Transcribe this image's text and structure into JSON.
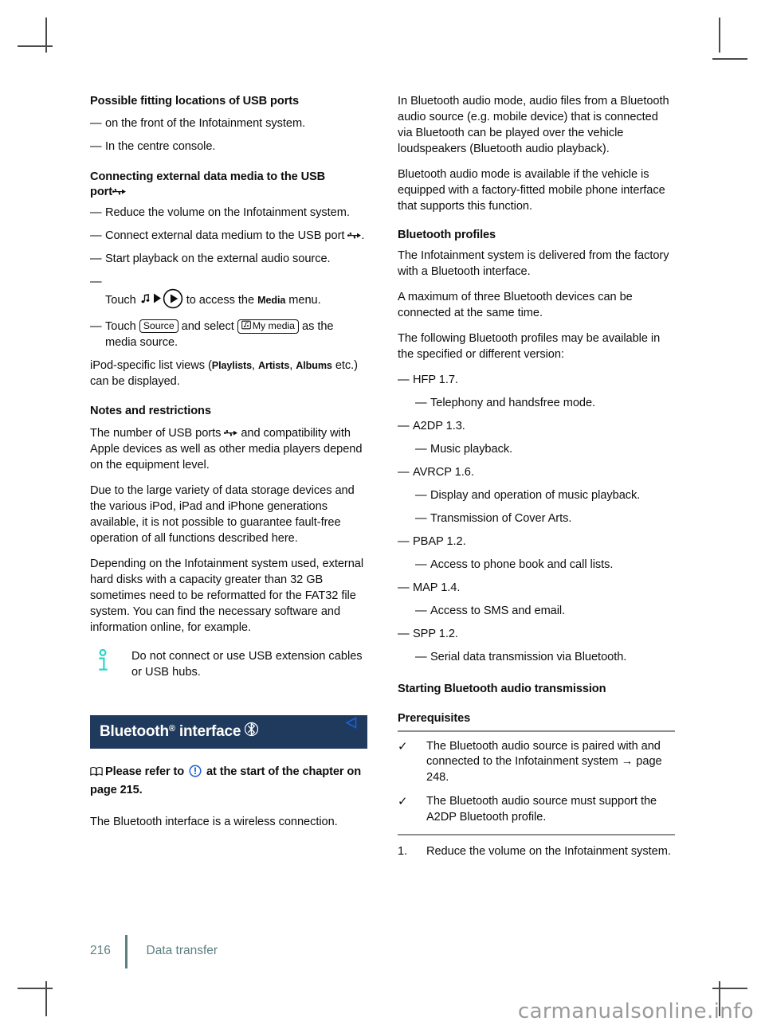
{
  "left_column": {
    "heading_1": "Possible fitting locations of USB ports",
    "list_1": [
      "on the front of the Infotainment system.",
      "In the centre console."
    ],
    "heading_2_line1": "Connecting external data media to the USB",
    "heading_2_line2": "port",
    "steps": {
      "step_1": "Reduce the volume on the Infotainment system.",
      "step_2_pre": "Connect external data medium to the USB port ",
      "step_2_post": ".",
      "step_3": "Start playback on the external audio source.",
      "step_4_pre": "Touch ",
      "step_4_mid": " to access the ",
      "step_4_ui": "Media",
      "step_4_post": " menu.",
      "step_5_pre": "Touch ",
      "step_5_chip_1": "Source",
      "step_5_mid": " and select ",
      "step_5_chip_2": "My media",
      "step_5_post": " as the media source."
    },
    "ipod_note_pre": "iPod-specific list views (",
    "ipod_ui_1": "Playlists",
    "ipod_ui_2": "Artists",
    "ipod_ui_3": "Albums",
    "ipod_note_post": " etc.) can be displayed.",
    "heading_3": "Notes and restrictions",
    "para_usb_pre": "The number of USB ports ",
    "para_usb_post": " and compatibility with Apple devices as well as other media players depend on the equipment level.",
    "para_variety": "Due to the large variety of data storage devices and the various iPod, iPad and iPhone generations available, it is not possible to guarantee fault-free operation of all functions described here.",
    "para_harddisk": "Depending on the Infotainment system used, external hard disks with a capacity greater than 32 GB sometimes need to be reformatted for the FAT32 file system. You can find the necessary software and information online, for example.",
    "note_text": "Do not connect or use USB extension cables or USB hubs.",
    "note_icon": "info-i-icon",
    "banner_title": "Bluetooth",
    "banner_sup": "®",
    "banner_title_2": "interface",
    "banner_icon": "bluetooth-icon",
    "refer_pre": "Please refer to ",
    "refer_post": " at the start of the chapter on page 215.",
    "refer_book_icon": "book-icon",
    "refer_warn_icon": "warning-circle-icon",
    "para_wireless": "The Bluetooth interface is a wireless connection."
  },
  "right_column": {
    "para_audio_mode": "In Bluetooth audio mode, audio files from a Bluetooth audio source (e.g. mobile device) that is connected via Bluetooth can be played over the vehicle loudspeakers (Bluetooth audio playback).",
    "para_available": "Bluetooth audio mode is available if the vehicle is equipped with a factory-fitted mobile phone interface that supports this function.",
    "heading_profiles": "Bluetooth profiles",
    "para_delivered": "The Infotainment system is delivered from the factory with a Bluetooth interface.",
    "para_maximum": "A maximum of three Bluetooth devices can be connected at the same time.",
    "para_following": "The following Bluetooth profiles may be available in the specified or different version:",
    "profiles": [
      {
        "name": "HFP 1.7.",
        "details": [
          "Telephony and handsfree mode."
        ]
      },
      {
        "name": "A2DP 1.3.",
        "details": [
          "Music playback."
        ]
      },
      {
        "name": "AVRCP 1.6.",
        "details": [
          "Display and operation of music playback.",
          "Transmission of Cover Arts."
        ]
      },
      {
        "name": "PBAP 1.2.",
        "details": [
          "Access to phone book and call lists."
        ]
      },
      {
        "name": "MAP 1.4.",
        "details": [
          "Access to SMS and email."
        ]
      },
      {
        "name": "SPP 1.2.",
        "details": [
          "Serial data transmission via Bluetooth."
        ]
      }
    ],
    "heading_starting": "Starting Bluetooth audio transmission",
    "heading_prerequisites": "Prerequisites",
    "prerequisites": [
      "The Bluetooth audio source is paired with and connected to the Infotainment system → page 248.",
      "The Bluetooth audio source must support the A2DP Bluetooth profile."
    ],
    "check_marker": "✓",
    "numbered_steps": [
      {
        "number": "1.",
        "text": "Reduce the volume on the Infotainment system."
      }
    ],
    "ref_arrow_icon": "left-triangle-marker"
  },
  "footer": {
    "page_number": "216",
    "section": "Data transfer"
  },
  "watermark": "carmanualsonline.info",
  "colors": {
    "banner_bg": "#1f3a5c",
    "note_icon": "#2ad6c8",
    "marker_blue": "#1b5fd9",
    "footer": "#5d7f80"
  }
}
